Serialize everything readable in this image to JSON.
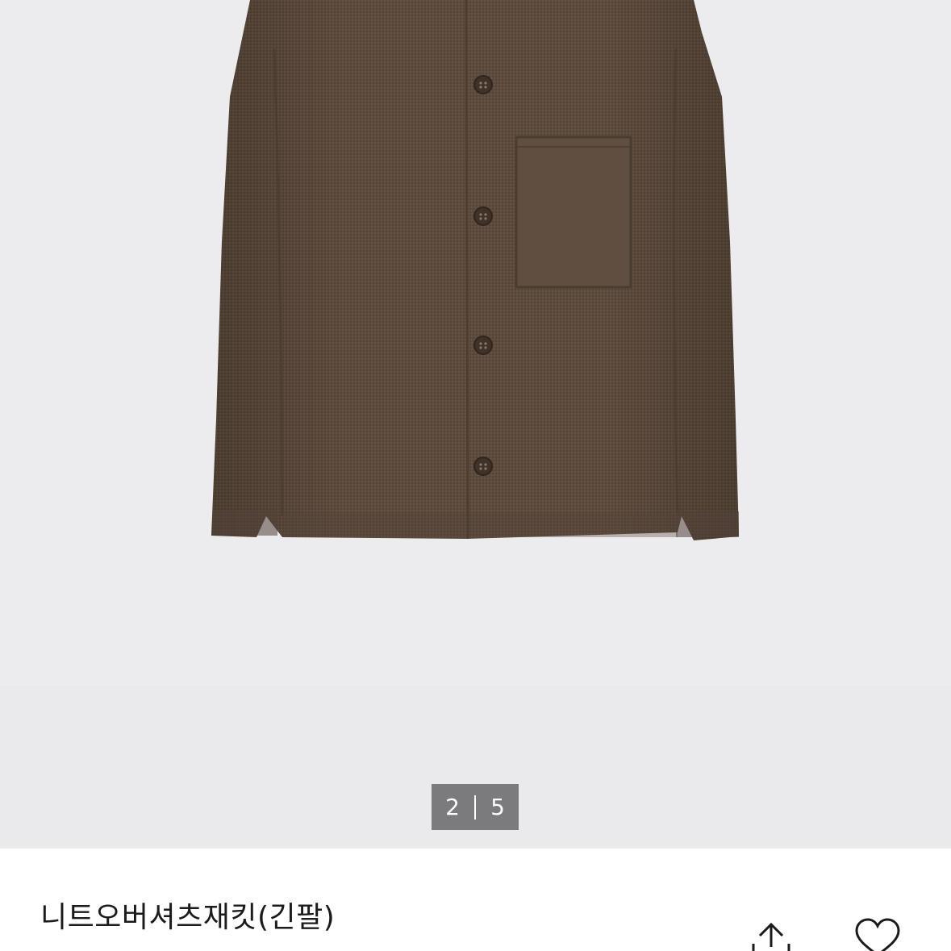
{
  "gallery": {
    "current_page": "2",
    "total_pages": "5",
    "image_icon": "jacket-product-photo"
  },
  "product": {
    "name": "니트오버셔츠재킷(긴팔)"
  },
  "actions": {
    "share_icon": "share-icon",
    "like_icon": "heart-icon"
  },
  "colors": {
    "gallery_bg": "#ececee",
    "jacket": "#5b4a3c",
    "indicator_bg": "#7b7b7d"
  }
}
